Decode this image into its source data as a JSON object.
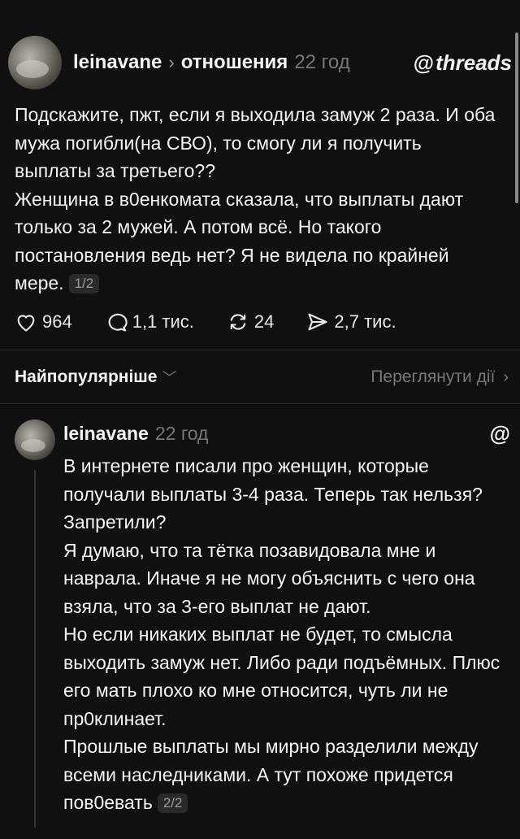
{
  "post": {
    "username": "leinavane",
    "separator": "›",
    "topic": "отношения",
    "time": "22 год",
    "app_logo_text": "threads",
    "app_logo_glyph": "@",
    "paragraphs": [
      "Подскажите, пжт, если я выходила замуж 2 раза. И оба мужа погибли(на СВО), то смогу ли я получить выплаты за третьего??",
      "Женщина в в0енкомата сказала, что выплаты дают только за 2 мужей. А потом всё. Но такого постановления ведь нет? Я не видела по крайней мере."
    ],
    "pager": "1/2",
    "likes": "964",
    "comments": "1,1 тис.",
    "reposts": "24",
    "shares": "2,7 тис."
  },
  "sort": {
    "label": "Найпопулярніше",
    "chevron": "﹀",
    "activity_label": "Переглянути дії",
    "activity_chevron": "›"
  },
  "reply": {
    "username": "leinavane",
    "time": "22 год",
    "logo_glyph": "@",
    "paragraphs": [
      "В интернете писали про женщин, которые получали выплаты 3-4 раза. Теперь так нельзя? Запретили?",
      "Я думаю, что та тётка позавидовала мне и наврала. Иначе я не могу объяснить с чего она взяла, что за 3-его выплат не дают.",
      "Но если никаких выплат не будет, то смысла выходить замуж нет. Либо ради подъёмных. Плюс его мать плохо ко мне относится, чуть ли не пр0клинает.",
      "Прошлые выплаты мы мирно разделили между всеми наследниками. А тут похоже придется пов0евать"
    ],
    "pager": "2/2"
  },
  "colors": {
    "background": "#101010",
    "text": "#f3f5f7",
    "muted": "#777777",
    "divider": "#2b2b2b"
  },
  "icons": {
    "like": "heart-icon",
    "comment": "comment-bubble-icon",
    "repost": "repost-icon",
    "share": "send-icon",
    "avatar": "avatar",
    "logo": "threads-logo-icon"
  }
}
